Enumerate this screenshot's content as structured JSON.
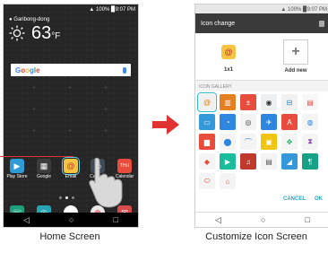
{
  "home": {
    "status": "▲ 100% ▉9:07 PM",
    "weather": {
      "location": "● Garibong-dong",
      "temp": "63",
      "unit": "°F"
    },
    "search": {
      "brand_parts": [
        "G",
        "o",
        "o",
        "g",
        "l",
        "e"
      ]
    },
    "apps": [
      {
        "label": "Play Store",
        "icon": "play-store-icon",
        "color": "#2e9bd6",
        "glyph": "▶"
      },
      {
        "label": "Google",
        "icon": "google-folder-icon",
        "color": "#3c3c3c",
        "glyph": "▦"
      },
      {
        "label": "Email",
        "icon": "email-icon",
        "color": "#f5c542",
        "glyph": "@"
      },
      {
        "label": "Camera",
        "icon": "camera-icon",
        "color": "#3f4a57",
        "glyph": "◉"
      },
      {
        "label": "Calendar",
        "icon": "calendar-icon",
        "color": "#e74c3c",
        "glyph": "THU"
      }
    ],
    "dock": [
      {
        "icon": "phone-icon",
        "color": "#1aa07a",
        "glyph": "☏"
      },
      {
        "icon": "contacts-icon",
        "color": "#27a4b4",
        "glyph": "◎"
      },
      {
        "icon": "apps-icon",
        "color": "#ffffff",
        "glyph": "⋯"
      },
      {
        "icon": "chrome-icon",
        "color": "#e8e8e8",
        "glyph": "◍"
      },
      {
        "icon": "messaging-icon",
        "color": "#d64b4b",
        "glyph": "✉"
      }
    ],
    "nav": [
      "◁",
      "○",
      "□"
    ]
  },
  "custom": {
    "status": "▲ 100% ▉9:07 PM",
    "title": "Icon change",
    "preview": [
      {
        "label": "1x1"
      },
      {
        "label": "Add new"
      }
    ],
    "gallery_title": "ICON GALLERY",
    "tiles": [
      {
        "color": "#f0f0f0",
        "glyph": "@",
        "fg": "#e07b00",
        "selected": true,
        "icon": "email-icon"
      },
      {
        "color": "#e67e22",
        "glyph": "▥",
        "fg": "#fff",
        "icon": "tools-icon"
      },
      {
        "color": "#e74c3c",
        "glyph": "±",
        "fg": "#fff",
        "icon": "calculator-icon"
      },
      {
        "color": "#ecf0f1",
        "glyph": "◉",
        "fg": "#333",
        "icon": "camera-icon"
      },
      {
        "color": "#f1f1f1",
        "glyph": "⊟",
        "fg": "#2980b9",
        "icon": "car-icon"
      },
      {
        "color": "#f7f7f7",
        "glyph": "▤",
        "fg": "#e74c3c",
        "icon": "notes-icon"
      },
      {
        "color": "#3498db",
        "glyph": "▭",
        "fg": "#fff",
        "icon": "card-icon"
      },
      {
        "color": "#2e86de",
        "glyph": "◔",
        "fg": "#fff",
        "icon": "chat-icon"
      },
      {
        "color": "#f4f4f4",
        "glyph": "◎",
        "fg": "#333",
        "icon": "contacts-icon"
      },
      {
        "color": "#2e86de",
        "glyph": "✈",
        "fg": "#fff",
        "icon": "plane-icon"
      },
      {
        "color": "#e74c3c",
        "glyph": "A",
        "fg": "#fff",
        "icon": "font-icon"
      },
      {
        "color": "#f4f4f4",
        "glyph": "◍",
        "fg": "#2e86de",
        "icon": "globe-icon"
      },
      {
        "color": "#e74c3c",
        "glyph": "▆",
        "fg": "#fff",
        "icon": "book-icon"
      },
      {
        "color": "#f4f4f4",
        "glyph": "⬤",
        "fg": "#2e86de",
        "icon": "person-icon"
      },
      {
        "color": "#f4f4f4",
        "glyph": "⌒",
        "fg": "#2e86de",
        "icon": "hanger-icon"
      },
      {
        "color": "#f1c40f",
        "glyph": "▣",
        "fg": "#fff",
        "icon": "folder-icon"
      },
      {
        "color": "#f4f4f4",
        "glyph": "✥",
        "fg": "#27ae60",
        "icon": "gamepad-icon"
      },
      {
        "color": "#f4f4f4",
        "glyph": "⧗",
        "fg": "#8e44ad",
        "icon": "hourglass-icon"
      },
      {
        "color": "#f4f4f4",
        "glyph": "◆",
        "fg": "#e74c3c",
        "icon": "map-icon"
      },
      {
        "color": "#1abc9c",
        "glyph": "▶",
        "fg": "#fff",
        "icon": "play-icon"
      },
      {
        "color": "#c0392b",
        "glyph": "♫",
        "fg": "#fff",
        "icon": "headphones-icon"
      },
      {
        "color": "#f4f4f4",
        "glyph": "▤",
        "fg": "#555",
        "icon": "memo-icon"
      },
      {
        "color": "#3498db",
        "glyph": "◢",
        "fg": "#fff",
        "icon": "picture-icon"
      },
      {
        "color": "#16a085",
        "glyph": "¶",
        "fg": "#fff",
        "icon": "dining-icon"
      },
      {
        "color": "#f4f4f4",
        "glyph": "⬭",
        "fg": "#e74c3c",
        "icon": "toggle-icon"
      },
      {
        "color": "#f4f4f4",
        "glyph": "⌂",
        "fg": "#e74c3c",
        "icon": "gift-icon"
      }
    ],
    "cancel": "CANCEL",
    "ok": "OK",
    "nav": [
      "◁",
      "○",
      "□"
    ]
  },
  "captions": {
    "home": "Home Screen",
    "custom": "Customize Icon Screen"
  },
  "colors": {
    "arrow": "#e23333",
    "highlight": "#5fd0e7",
    "accent": "#2aa1c0"
  }
}
